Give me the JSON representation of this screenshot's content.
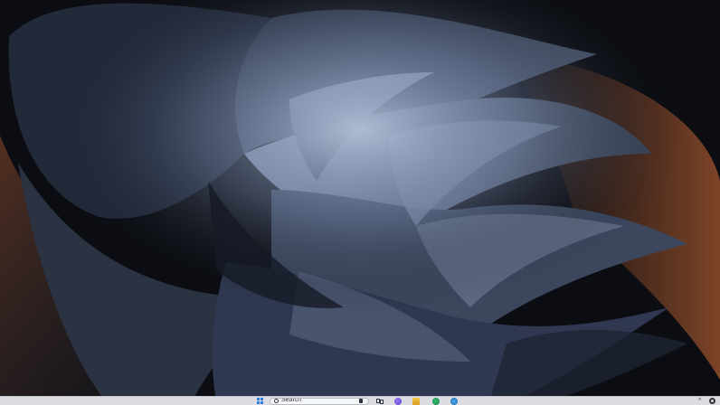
{
  "desktop": {
    "wallpaper": "windows-11-bloom-dark-wallpaper"
  },
  "taskbar": {
    "start": {
      "icon": "windows-logo-icon",
      "color": "#2a7be0"
    },
    "search": {
      "placeholder": "Search",
      "icon": "search-icon"
    },
    "apps": [
      {
        "name": "task-view",
        "icon": "task-view-icon"
      },
      {
        "name": "copilot",
        "icon": "copilot-icon",
        "color": "#7a5ce0"
      },
      {
        "name": "file-explorer",
        "icon": "folder-icon",
        "color": "#f0b93a"
      },
      {
        "name": "edge",
        "icon": "edge-icon",
        "color": "#1f9a5a"
      },
      {
        "name": "store",
        "icon": "store-icon",
        "color": "#2e7fd0"
      }
    ],
    "tray": {
      "chevron": "^",
      "settings_icon": "gear-icon"
    }
  }
}
